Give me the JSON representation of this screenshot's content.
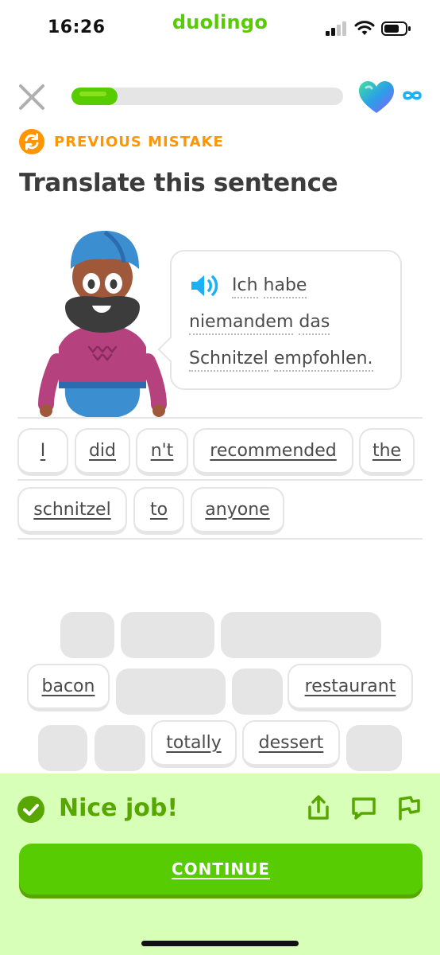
{
  "status_bar": {
    "time": "16:26",
    "brand": "duolingo",
    "icons": [
      "signal-icon",
      "wifi-icon",
      "battery-icon"
    ]
  },
  "lesson_header": {
    "progress": 0.17,
    "hearts": "∞",
    "icons": [
      "close-icon",
      "heart-icon",
      "infinity-icon"
    ]
  },
  "banner": {
    "label": "PREVIOUS MISTAKE",
    "icon": "refresh-icon"
  },
  "prompt": {
    "title": "Translate this sentence"
  },
  "speech": {
    "words": [
      "Ich",
      "habe",
      "niemandem",
      "das",
      "Schnitzel",
      "empfohlen."
    ],
    "icon": "speaker-icon"
  },
  "answer": {
    "tiles": [
      "I",
      "did",
      "n't",
      "recommended",
      "the",
      "schnitzel",
      "to",
      "anyone"
    ]
  },
  "word_bank": {
    "tiles": [
      "bacon",
      "restaurant",
      "totally",
      "dessert"
    ]
  },
  "feedback": {
    "message": "Nice job!",
    "continue_label": "CONTINUE",
    "icons": [
      "check-icon",
      "share-icon",
      "comment-icon",
      "flag-icon"
    ]
  },
  "colors": {
    "brand_green": "#58cc02",
    "dark_green": "#58a700",
    "feedback_bg": "#d7ffb8",
    "orange": "#ff9600",
    "tile_border": "#e5e5e5"
  }
}
